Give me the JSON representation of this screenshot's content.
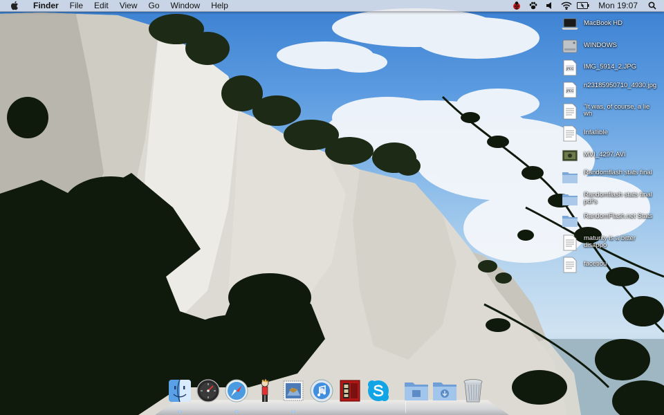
{
  "menubar": {
    "apple_icon": "apple-logo-icon",
    "menus": [
      "Finder",
      "File",
      "Edit",
      "View",
      "Go",
      "Window",
      "Help"
    ],
    "status_icons": [
      "ladybug-icon",
      "paw-icon",
      "volume-icon",
      "wifi-icon",
      "battery-icon"
    ],
    "clock": "Mon 19:07",
    "spotlight_icon": "spotlight-search-icon"
  },
  "desktop": {
    "items": [
      {
        "label": "MacBook HD",
        "icon": "laptop-drive-icon"
      },
      {
        "label": "WINDOWS",
        "icon": "hard-drive-icon"
      },
      {
        "label": "IMG_5914_2.JPG",
        "icon": "jpeg-file-icon"
      },
      {
        "label": "n23185950710_4930.jpg",
        "icon": "jpeg-file-icon"
      },
      {
        "label": "\"It was, of course, a lie wh",
        "icon": "text-document-icon"
      },
      {
        "label": "Infallible",
        "icon": "text-document-icon"
      },
      {
        "label": "MVI_4297.AVI",
        "icon": "video-file-icon"
      },
      {
        "label": "Randomflash stats final",
        "icon": "folder-icon"
      },
      {
        "label": "Randomflash stats final pdf's",
        "icon": "folder-icon"
      },
      {
        "label": "RandomFlash.net Stats",
        "icon": "folder-icon"
      },
      {
        "label": "maturity is a bitter disappo",
        "icon": "text-document-icon"
      },
      {
        "label": "facetiou",
        "icon": "text-document-icon"
      }
    ]
  },
  "dock": {
    "apps": [
      {
        "name": "Finder",
        "icon": "finder-icon",
        "running": true
      },
      {
        "name": "Dashboard",
        "icon": "dashboard-icon",
        "running": false
      },
      {
        "name": "Safari",
        "icon": "safari-icon",
        "running": true
      },
      {
        "name": "Calvin",
        "icon": "calvin-character-icon",
        "running": false
      },
      {
        "name": "Mail",
        "icon": "mail-stamp-icon",
        "running": true
      },
      {
        "name": "iTunes",
        "icon": "itunes-icon",
        "running": false
      },
      {
        "name": "Photo Booth",
        "icon": "photo-booth-icon",
        "running": false
      },
      {
        "name": "Skype",
        "icon": "skype-icon",
        "running": false
      }
    ],
    "stacks": [
      {
        "name": "Applications",
        "icon": "applications-folder-icon"
      },
      {
        "name": "Downloads",
        "icon": "downloads-folder-icon"
      }
    ],
    "trash": {
      "name": "Trash",
      "icon": "trash-icon"
    }
  }
}
